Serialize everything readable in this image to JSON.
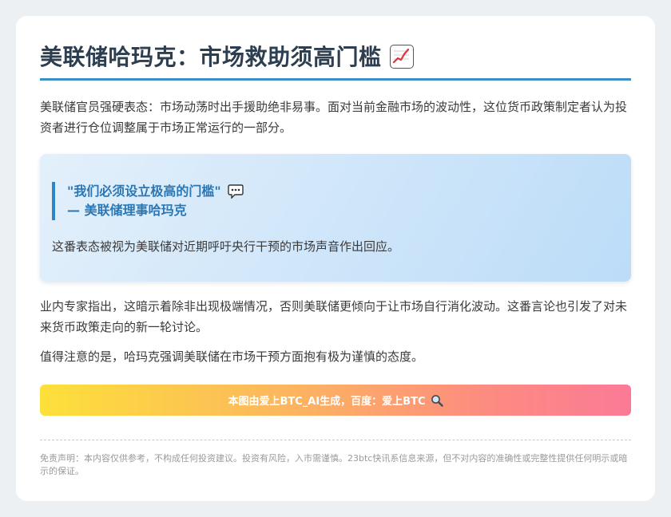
{
  "article": {
    "title": "美联储哈玛克：市场救助须高门槛",
    "title_icon": "chart-increasing-icon",
    "paragraph1": "美联储官员强硬表态：市场动荡时出手援助绝非易事。面对当前金融市场的波动性，这位货币政策制定者认为投资者进行仓位调整属于市场正常运行的一部分。",
    "quote": {
      "text": "\"我们必须设立极高的门槛\"",
      "icon": "speech-balloon-icon",
      "attribution": "— 美联储理事哈玛克",
      "note": "这番表态被视为美联储对近期呼吁央行干预的市场声音作出回应。"
    },
    "paragraph2": "业内专家指出，这暗示着除非出现极端情况，否则美联储更倾向于让市场自行消化波动。这番言论也引发了对未来货币政策走向的新一轮讨论。",
    "paragraph3": "值得注意的是，哈玛克强调美联储在市场干预方面抱有极为谨慎的态度。",
    "banner": {
      "text": "本图由爱上BTC_AI生成，百度：爱上BTC",
      "icon": "magnifying-glass-icon"
    },
    "disclaimer": "免责声明：本内容仅供参考，不构成任何投资建议。投资有风险，入市需谨慎。23btc快讯系信息来源，但不对内容的准确性或完整性提供任何明示或暗示的保证。"
  },
  "colors": {
    "title": "#2c3e50",
    "accent": "#3a8fc2",
    "quote_text": "#2a77b4",
    "banner_start": "#fde03a",
    "banner_end": "#fb7a96"
  }
}
